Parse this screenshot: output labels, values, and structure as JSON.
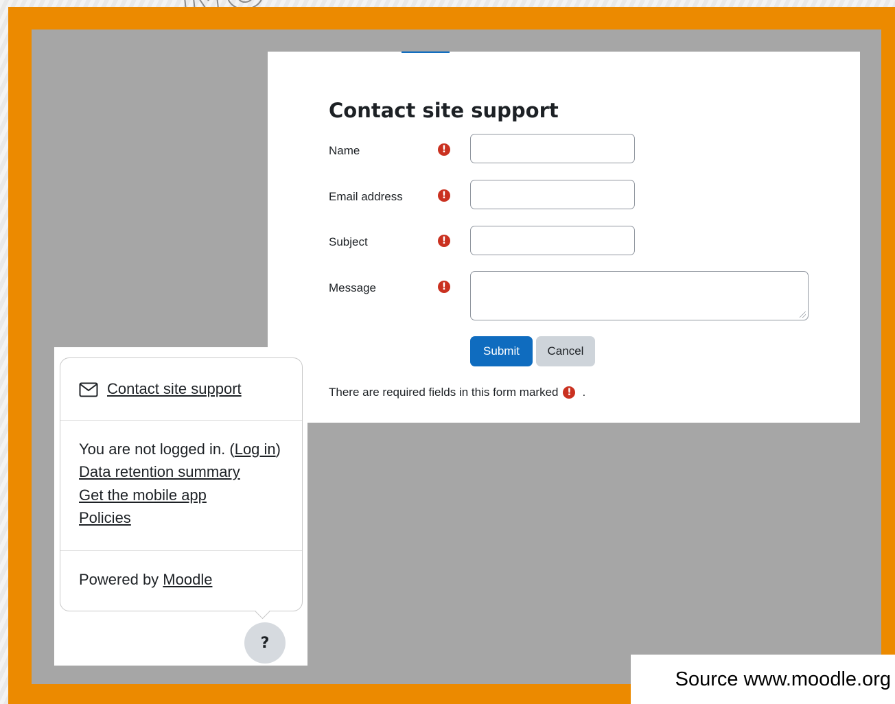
{
  "form": {
    "title": "Contact site support",
    "fields": [
      {
        "label": "Name",
        "value": ""
      },
      {
        "label": "Email address",
        "value": ""
      },
      {
        "label": "Subject",
        "value": ""
      },
      {
        "label": "Message",
        "value": ""
      }
    ],
    "required_icon": "exclamation-circle-icon",
    "submit_label": "Submit",
    "cancel_label": "Cancel",
    "required_note": "There are required fields in this form marked",
    "required_note_end": ".",
    "accent_color": "#0f6cbf",
    "required_color": "#ca3120"
  },
  "footer_popover": {
    "contact_link": "Contact site support",
    "contact_icon": "envelope-icon",
    "login_status": "You are not logged in. (",
    "login_link": "Log in",
    "login_status_end": ")",
    "links": [
      "Data retention summary",
      "Get the mobile app",
      "Policies"
    ],
    "powered_by": "Powered by ",
    "moodle_link": "Moodle",
    "help_button": "?"
  },
  "source": "Source www.moodle.org",
  "frame_color": "#ec8a00"
}
